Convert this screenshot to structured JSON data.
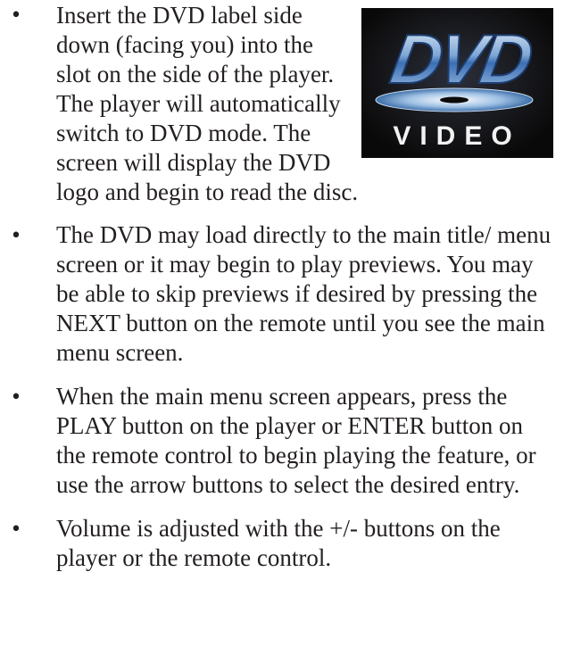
{
  "bullet_symbol": "•",
  "logo": {
    "icon": "dvd-video-logo",
    "text_main": "DVD",
    "text_sub": "VIDEO"
  },
  "items": [
    {
      "text": "Insert the DVD label side down (facing you) into the slot on the side of the player. The player will automatically switch to DVD mode. The screen will display the DVD logo and begin to read the disc."
    },
    {
      "text": "The DVD may load directly to the main title/ menu screen or it may begin to play previews. You may be able to skip previews if desired by pressing the NEXT button on the remote until you see the main menu screen."
    },
    {
      "text": "When the main menu screen appears, press the PLAY button on the player or ENTER button on the remote control to begin playing the feature, or use the arrow buttons to select the desired entry."
    },
    {
      "text": "Volume is adjusted with the +/- buttons on the player or the remote control."
    }
  ]
}
